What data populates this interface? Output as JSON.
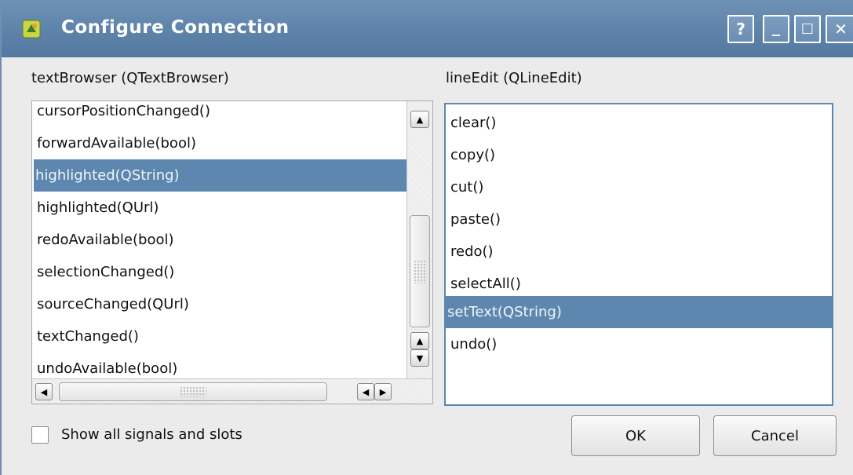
{
  "window": {
    "title": "Configure Connection",
    "buttons": {
      "help": "?",
      "minimize": "_",
      "maximize": "☐",
      "close": "✕"
    }
  },
  "left_panel": {
    "label": "textBrowser (QTextBrowser)",
    "items": [
      "cursorPositionChanged()",
      "forwardAvailable(bool)",
      "highlighted(QString)",
      "highlighted(QUrl)",
      "redoAvailable(bool)",
      "selectionChanged()",
      "sourceChanged(QUrl)",
      "textChanged()",
      "undoAvailable(bool)"
    ],
    "selected": "highlighted(QString)"
  },
  "right_panel": {
    "label": "lineEdit (QLineEdit)",
    "items": [
      "clear()",
      "copy()",
      "cut()",
      "paste()",
      "redo()",
      "selectAll()",
      "setText(QString)",
      "undo()"
    ],
    "selected": "setText(QString)"
  },
  "footer": {
    "show_all_label": "Show all signals and slots",
    "show_all_checked": false,
    "ok_label": "OK",
    "cancel_label": "Cancel"
  },
  "colors": {
    "titlebar": "#5f84ab",
    "selection": "#5d87ae"
  }
}
